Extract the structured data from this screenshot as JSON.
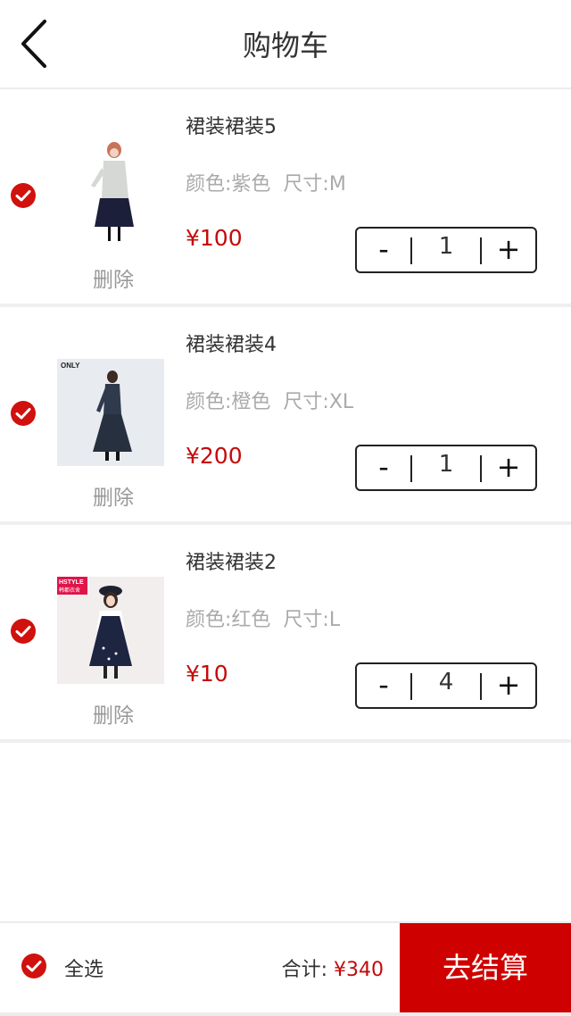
{
  "header": {
    "title": "购物车"
  },
  "items": [
    {
      "name": "裙装裙装5",
      "color_label": "颜色:紫色",
      "size_label": "尺寸:M",
      "price": "¥100",
      "quantity": "1",
      "delete_label": "删除",
      "minus_label": "-",
      "plus_label": "+",
      "checked": true
    },
    {
      "name": "裙装裙装4",
      "color_label": "颜色:橙色",
      "size_label": "尺寸:XL",
      "price": "¥200",
      "quantity": "1",
      "delete_label": "删除",
      "minus_label": "-",
      "plus_label": "+",
      "checked": true,
      "image_text": "ONLY"
    },
    {
      "name": "裙装裙装2",
      "color_label": "颜色:红色",
      "size_label": "尺寸:L",
      "price": "¥10",
      "quantity": "4",
      "delete_label": "删除",
      "minus_label": "-",
      "plus_label": "+",
      "checked": true,
      "image_text_1": "HSTYLE",
      "image_text_2": "韩都衣舍"
    }
  ],
  "footer": {
    "select_all_label": "全选",
    "total_label": "合计:",
    "total_amount": "¥340",
    "checkout_label": "去结算",
    "select_all_checked": true
  },
  "colors": {
    "accent": "#d0110d",
    "price": "#c40a0a",
    "checkout_bg": "#cf0000"
  },
  "icons": {
    "back": "chevron-left-icon",
    "check": "check-circle-icon"
  }
}
